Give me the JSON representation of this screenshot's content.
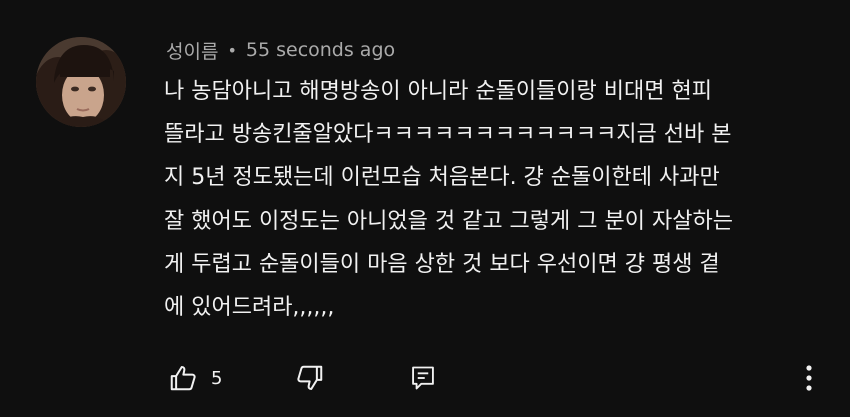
{
  "comment": {
    "author": "성이름",
    "separator": "•",
    "timestamp": "55 seconds ago",
    "lines": [
      "나 농담아니고 해명방송이 아니라 순돌이들이랑 비대면 현피",
      "뜰라고 방송킨줄알았다ㅋㅋㅋㅋㅋㅋㅋㅋㅋㅋㅋㅋ지금 선바 본",
      "지 5년 정도됐는데 이런모습 처음본다. 걍 순돌이한테 사과만",
      "잘 했어도 이정도는 아니었을 것 같고 그렇게 그 분이 자살하는",
      "게 두렵고 순돌이들이 마음 상한 것 보다 우선이면 걍 평생 곁",
      "에 있어드려라,,,,,,"
    ],
    "like_count": "5"
  },
  "icons": {
    "avatar": "avatar",
    "like": "thumbs-up-icon",
    "dislike": "thumbs-down-icon",
    "reply": "reply-comment-icon",
    "more": "more-vertical-icon"
  },
  "colors": {
    "background": "#0f0f0f",
    "text": "#f1f1f1",
    "meta": "#aaaaaa"
  }
}
